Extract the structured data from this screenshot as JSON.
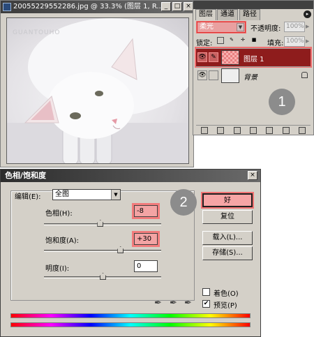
{
  "document_window": {
    "title": "20055229552286.jpg @ 33.3% (图层 1, R...",
    "watermark": "GUANTOUHO",
    "buttons": [
      "_",
      "□",
      "×"
    ]
  },
  "layers_panel": {
    "tabs": [
      "图层",
      "通道",
      "路径"
    ],
    "menu_button": "▸",
    "blend_mode": "柔光",
    "opacity_label": "不透明度:",
    "opacity_value": "100%",
    "lock_label": "锁定:",
    "fill_label": "填充:",
    "fill_value": "100%",
    "layers": [
      {
        "name": "图层 1",
        "selected": true
      },
      {
        "name": "背景",
        "selected": false,
        "locked": true
      }
    ],
    "step_marker": "1",
    "toolbar_icons": [
      "link-icon",
      "fx-icon",
      "mask-icon",
      "folder-icon",
      "adjustment-icon",
      "new-layer-icon",
      "trash-icon"
    ]
  },
  "hue_saturation_dialog": {
    "title": "色相/饱和度",
    "close_label": "×",
    "edit_label": "编辑(E):",
    "edit_value": "全图",
    "hue_label": "色相(H):",
    "hue_value": "-8",
    "hue": -8,
    "saturation_label": "饱和度(A):",
    "saturation_value": "+30",
    "saturation": 30,
    "lightness_label": "明度(I):",
    "lightness_value": "0",
    "lightness": 0,
    "step_marker": "2",
    "ok_label": "好",
    "reset_label": "复位",
    "load_label": "载入(L)...",
    "save_label": "存储(S)...",
    "colorize_label": "着色(O)",
    "colorize_checked": false,
    "preview_label": "预览(P)",
    "preview_checked": true
  },
  "colors": {
    "highlight": "#f27373",
    "selected_layer": "#8e1c1c",
    "dialog_bg": "#d4d0c8"
  }
}
